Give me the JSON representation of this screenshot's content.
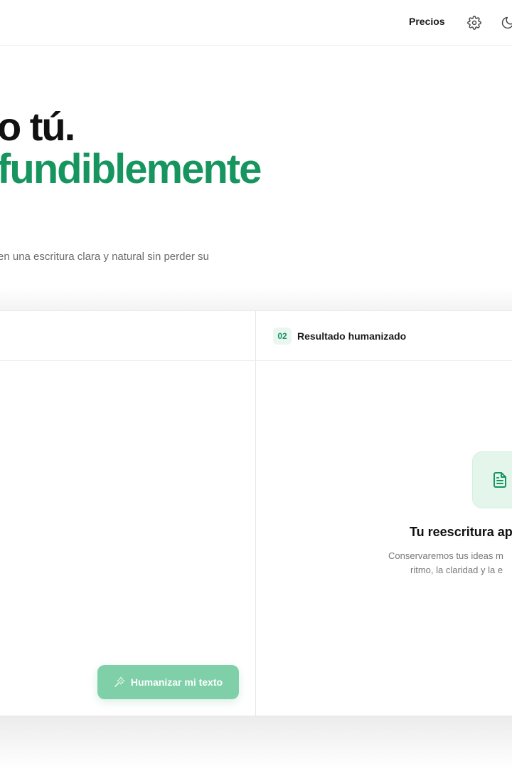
{
  "header": {
    "pricing_label": "Precios",
    "settings_icon": "gear-icon",
    "theme_icon": "moon-icon"
  },
  "hero": {
    "line1": "o tú.",
    "line2": "fundiblemente",
    "subtitle": "en una escritura clara y natural sin perder su"
  },
  "input_panel": {
    "action_label": "Humanizar mi texto",
    "action_icon": "magic-wand-icon"
  },
  "output_panel": {
    "step_number": "02",
    "title": "Resultado humanizado",
    "empty_icon": "document-icon",
    "empty_title": "Tu reescritura ap",
    "empty_desc_line1": "Conservaremos tus ideas m",
    "empty_desc_line2": "ritmo, la claridad y la e"
  },
  "colors": {
    "accent": "#16955f",
    "accent_light": "#7fd0a9",
    "badge_bg": "#eaf7f0"
  }
}
